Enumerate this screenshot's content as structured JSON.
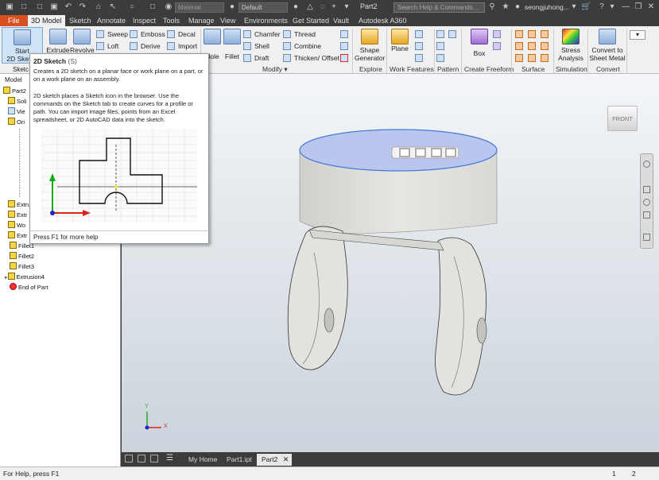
{
  "app": {
    "document_title": "Part2",
    "user": "seongjuhong...",
    "material": "Material",
    "appearance": "Default",
    "search_placeholder": "Search Help & Commands..."
  },
  "menu": [
    "File",
    "3D Model",
    "Sketch",
    "Annotate",
    "Inspect",
    "Tools",
    "Manage",
    "View",
    "Environments",
    "Get Started",
    "Vault",
    "Autodesk A360"
  ],
  "ribbon": {
    "start_sketch": "Start\n2D Sketch",
    "extrude": "Extrude",
    "revolve": "Revolve",
    "sweep": "Sweep",
    "loft": "Loft",
    "emboss": "Emboss",
    "derive": "Derive",
    "decal": "Decal",
    "import": "Import",
    "hole": "Hole",
    "fillet": "Fillet",
    "chamfer": "Chamfer",
    "shell": "Shell",
    "draft": "Draft",
    "thread": "Thread",
    "combine": "Combine",
    "thicken": "Thicken/ Offset",
    "modify_label": "Modify ▾",
    "shape_generator": "Shape\nGenerator",
    "explore_label": "Explore",
    "plane": "Plane",
    "work_features_label": "Work Features",
    "pattern_label": "Pattern",
    "box": "Box",
    "freeform_label": "Create Freeform",
    "surface_label": "Surface",
    "stress": "Stress\nAnalysis",
    "simulation_label": "Simulation",
    "convert_sheet": "Convert to\nSheet Metal",
    "convert_label": "Convert"
  },
  "browser": {
    "tabs": [
      "Sketc",
      "Model"
    ],
    "root": "Part2",
    "items": [
      "Soli",
      "Vie",
      "Ori",
      "Extru",
      "Extr",
      "Wo",
      "Extr",
      "Fillet1",
      "Fillet2",
      "Fillet3",
      "Extrusion4",
      "End of Part"
    ]
  },
  "tooltip": {
    "title": "2D Sketch",
    "shortcut": "(S)",
    "line1": "Creates a 2D sketch on a planar face or work plane on a part, or on a work plane on an assembly.",
    "line2": "2D sketch places a Sketch icon in the browser. Use the commands on the Sketch tab to create curves for a profile or path. You can import image files, points from an Excel spreadsheet, or 2D AutoCAD data into the sketch.",
    "help": "Press F1 for more help"
  },
  "viewcube": {
    "face": "FRONT"
  },
  "axes": {
    "x": "X",
    "y": "Y"
  },
  "doc_tabs": [
    "My Home",
    "Part1.ipt",
    "Part2"
  ],
  "status": {
    "text": "For Help, press F1",
    "count1": "1",
    "count2": "2"
  }
}
